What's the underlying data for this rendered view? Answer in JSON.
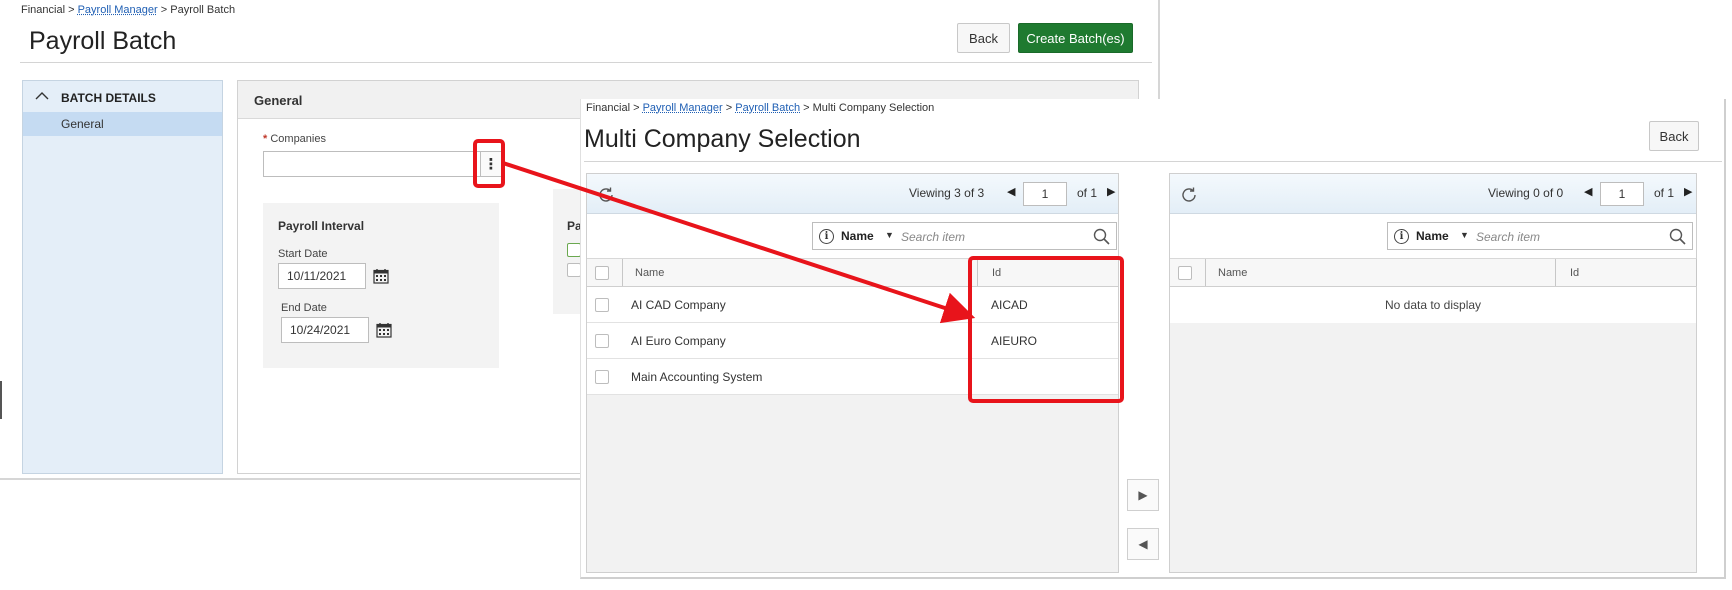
{
  "background": {
    "breadcrumb": {
      "root": "Financial",
      "sep1": ">",
      "link": "Payroll Manager",
      "sep2": ">",
      "current": "Payroll Batch"
    },
    "title": "Payroll Batch",
    "buttons": {
      "back": "Back",
      "create": "Create Batch(es)"
    },
    "sidebar": {
      "section": "BATCH DETAILS",
      "items": [
        {
          "label": "General"
        }
      ]
    },
    "main": {
      "section_title": "General",
      "companies": {
        "required_mark": "*",
        "label": "Companies",
        "value": ""
      },
      "payroll_interval": {
        "title": "Payroll Interval",
        "start_label": "Start Date",
        "start_value": "10/11/2021",
        "end_label": "End Date",
        "end_value": "10/24/2021"
      },
      "second_card_title_partial": "Pa"
    }
  },
  "overlay": {
    "breadcrumb": {
      "root": "Financial",
      "sep1": ">",
      "link1": "Payroll Manager",
      "sep2": ">",
      "link2": "Payroll Batch",
      "sep3": ">",
      "current": "Multi Company Selection"
    },
    "title": "Multi Company Selection",
    "back_button": "Back",
    "left_grid": {
      "viewing_label": "Viewing",
      "viewing_count": "3 of 3",
      "page": "1",
      "of_pages": "of 1",
      "search_field": "Name",
      "search_placeholder": "Search item",
      "columns": {
        "name": "Name",
        "id": "Id"
      },
      "rows": [
        {
          "name": "AI CAD Company",
          "id": "AICAD"
        },
        {
          "name": "AI Euro Company",
          "id": "AIEURO"
        },
        {
          "name": "Main Accounting System",
          "id": ""
        }
      ]
    },
    "right_grid": {
      "viewing_label": "Viewing",
      "viewing_count": "0 of 0",
      "page": "1",
      "of_pages": "of 1",
      "search_field": "Name",
      "search_placeholder": "Search item",
      "columns": {
        "name": "Name",
        "id": "Id"
      },
      "empty_text": "No data to display"
    }
  },
  "colors": {
    "accent_link": "#1f5fb4",
    "primary_button": "#1f7a30",
    "annotation": "#e8141b"
  },
  "icons": [
    "kebab-menu-icon",
    "calendar-icon",
    "refresh-icon",
    "info-icon",
    "search-icon",
    "arrow-right-icon",
    "arrow-left-icon",
    "chevron-up-icon"
  ]
}
